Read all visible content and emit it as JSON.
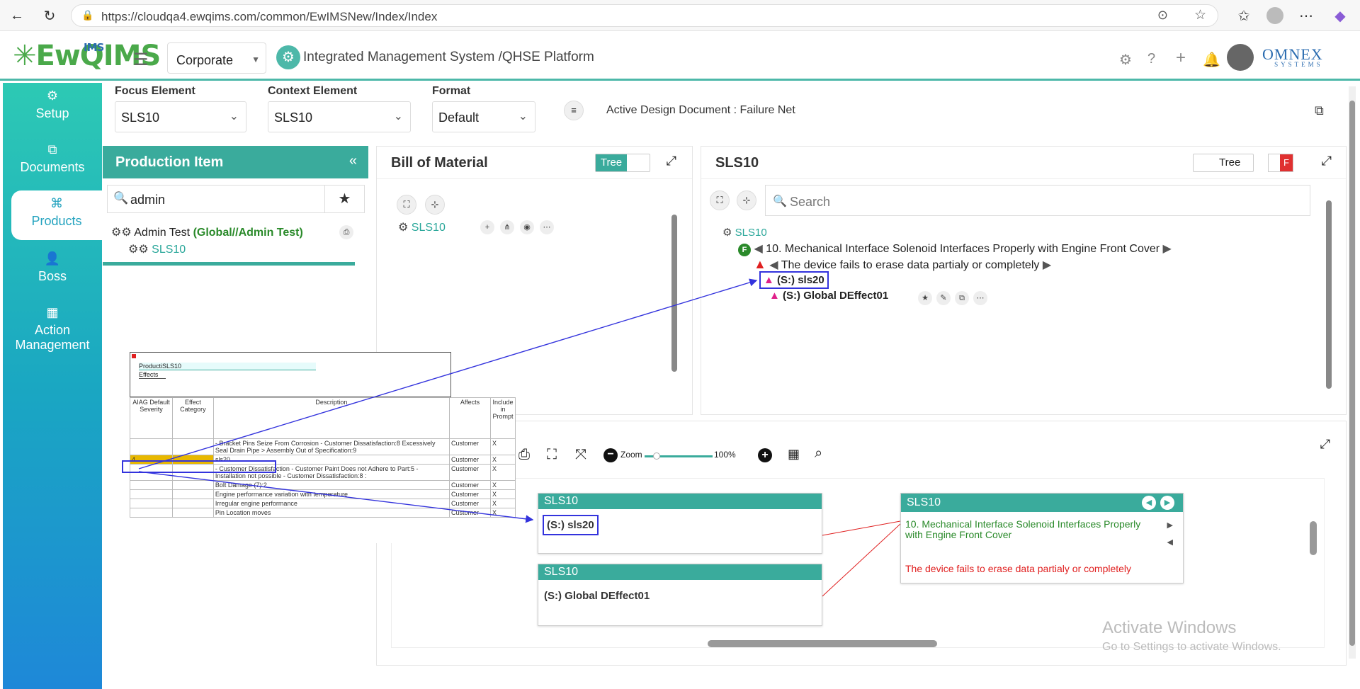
{
  "browser": {
    "url": "https://cloudqa4.ewqims.com/common/EwIMSNew/Index/Index"
  },
  "header": {
    "logo": "EwQIMS",
    "logo_sup": "IMS",
    "corporate": "Corporate",
    "title": "Integrated Management System /QHSE Platform",
    "brand": "OMNEX",
    "brand_sub": "SYSTEMS"
  },
  "nav": [
    {
      "label": "Setup",
      "icon": "gears-icon"
    },
    {
      "label": "Documents",
      "icon": "documents-icon"
    },
    {
      "label": "Products",
      "icon": "products-icon"
    },
    {
      "label": "Boss",
      "icon": "user-icon"
    },
    {
      "label": "Action Management",
      "icon": "building-icon"
    }
  ],
  "toolbar": {
    "focus_label": "Focus Element",
    "focus_value": "SLS10",
    "context_label": "Context Element",
    "context_value": "SLS10",
    "format_label": "Format",
    "format_value": "Default",
    "active_doc": "Active Design Document : Failure Net"
  },
  "production": {
    "title": "Production Item",
    "search_value": "admin",
    "root_label": "Admin Test",
    "root_tag": "(Global//Admin Test)",
    "child_label": "SLS10"
  },
  "bom": {
    "title": "Bill of Material",
    "toggle": "Tree",
    "item": "SLS10"
  },
  "sls": {
    "title": "SLS10",
    "toggle": "Tree",
    "badge": "F",
    "search_placeholder": "Search",
    "root": "SLS10",
    "function": "10. Mechanical Interface Solenoid Interfaces Properly with Engine Front Cover",
    "failure": "The device fails to erase data partialy or completely",
    "effect1": "(S:) sls20",
    "effect2": "(S:) Global DEffect01"
  },
  "overlay": {
    "header1": "ProductiSLS10",
    "header2": "Effects",
    "columns": [
      "AIAG Default Severity",
      "Effect Category",
      "Description",
      "Affects",
      "Include in Prompt"
    ],
    "rows": [
      [
        "",
        "",
        "- Bracket Pins Seize From Corrosion - Customer Dissatisfaction:8 Excessively Seal Drain Pipe > Assembly Out of Specification:9",
        "Customer",
        "X"
      ],
      [
        "4",
        "",
        "sls20",
        "Customer",
        "X"
      ],
      [
        "",
        "",
        "- Customer Dissatisfaction - Customer Paint Does not Adhere to Part:5 - Installation not possible - Customer Dissatisfaction:8 :",
        "Customer",
        "X"
      ],
      [
        "",
        "",
        "Bolt Damage (7):2",
        "Customer",
        "X"
      ],
      [
        "",
        "",
        "Engine performance variation with temperature",
        "Customer",
        "X"
      ],
      [
        "",
        "",
        "Irregular engine performance",
        "Customer",
        "X"
      ],
      [
        "",
        "",
        "Pin Location moves",
        "Customer",
        "X"
      ]
    ]
  },
  "diagram": {
    "zoom_label": "Zoom",
    "zoom_value": "100%",
    "node1_head": "SLS10",
    "node1_body": "(S:) sls20",
    "node2_head": "SLS10",
    "node2_body": "(S:) Global DEffect01",
    "node3_head": "SLS10",
    "node3_function": "10. Mechanical Interface Solenoid Interfaces Properly with Engine Front Cover",
    "node3_failure": "The device fails to erase data partialy or completely"
  },
  "watermark": {
    "line1": "Activate Windows",
    "line2": "Go to Settings to activate Windows."
  },
  "colors": {
    "accent": "#3aab9c",
    "highlight": "#3333dd",
    "failure_red": "#e02020",
    "function_green": "#2a8a2a"
  }
}
